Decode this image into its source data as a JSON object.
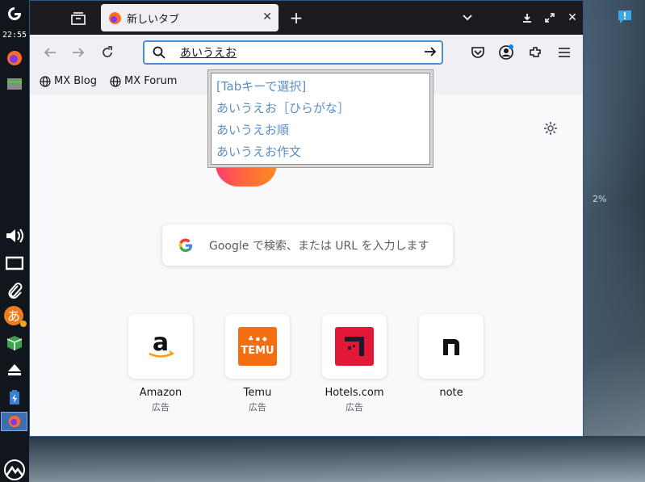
{
  "panel": {
    "clock": "22:55"
  },
  "browser": {
    "tab_title": "新しいタブ",
    "url_value": "あいうえお",
    "bookmarks": [
      "MX Blog",
      "MX Forum"
    ]
  },
  "ime": {
    "candidates": [
      "[Tabキーで選択]",
      "あいうえお［ひらがな］",
      "あいうえお順",
      "あいうえお作文"
    ]
  },
  "newtab": {
    "search_placeholder": "Google で検索、または URL を入力します",
    "tiles": [
      {
        "name": "Amazon",
        "sponsor": "広告"
      },
      {
        "name": "Temu",
        "sponsor": "広告"
      },
      {
        "name": "Hotels.com",
        "sponsor": "広告"
      },
      {
        "name": "note",
        "sponsor": ""
      }
    ]
  },
  "desktop": {
    "percent_label": "2%"
  },
  "colors": {
    "accent": "#4a90d9",
    "ime_text": "#5a8fc4",
    "tabbar": "#1c1b22",
    "panel": "#10161c"
  }
}
